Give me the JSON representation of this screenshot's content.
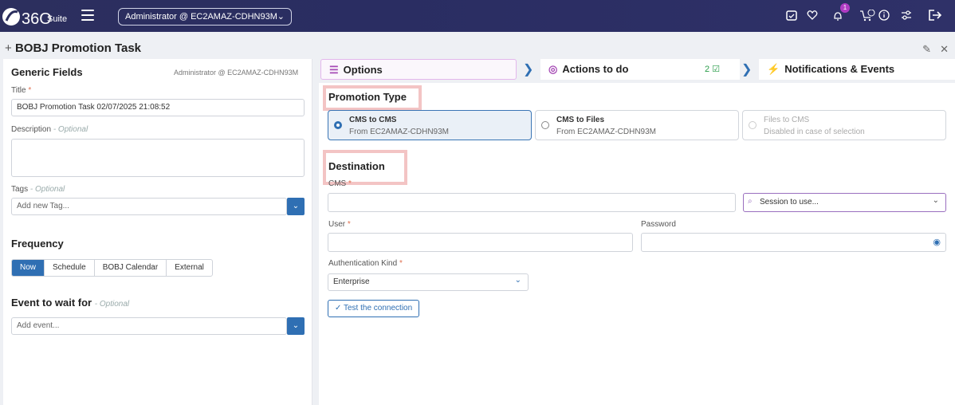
{
  "topbar": {
    "logo_text": "Suite",
    "user_select": "Administrator @ EC2AMAZ-CDHN93M",
    "notification_count": "1",
    "icons": [
      "calendar-check-icon",
      "heart-icon",
      "bell-icon",
      "cart-icon",
      "info-icon",
      "settings-icon",
      "logout-icon"
    ]
  },
  "page": {
    "title": "BOBJ Promotion Task",
    "title_prefix": "+"
  },
  "generic": {
    "heading": "Generic Fields",
    "user": "Administrator @ EC2AMAZ-CDHN93M",
    "title_label": "Title",
    "title_value": "BOBJ Promotion Task 02/07/2025 21:08:52",
    "description_label": "Description",
    "optional": "- Optional",
    "tags_label": "Tags",
    "tags_placeholder": "Add new Tag..."
  },
  "frequency": {
    "heading": "Frequency",
    "options": [
      "Now",
      "Schedule",
      "BOBJ Calendar",
      "External"
    ],
    "selected": "Now"
  },
  "event": {
    "heading": "Event to wait for",
    "optional": "- Optional",
    "placeholder": "Add event..."
  },
  "tabs": {
    "options": "Options",
    "actions": "Actions to do",
    "actions_count": "2",
    "notifications": "Notifications & Events"
  },
  "promotion": {
    "heading": "Promotion Type",
    "options": [
      {
        "title": "CMS to CMS",
        "sub": "From EC2AMAZ-CDHN93M"
      },
      {
        "title": "CMS to Files",
        "sub": "From EC2AMAZ-CDHN93M"
      },
      {
        "title": "Files to CMS",
        "sub": "Disabled in case of selection"
      }
    ]
  },
  "destination": {
    "heading": "Destination",
    "cms_label": "CMS",
    "session_placeholder": "Session to use...",
    "user_label": "User",
    "password_label": "Password",
    "auth_label": "Authentication Kind",
    "auth_value": "Enterprise",
    "test_button": "Test the connection"
  },
  "colors": {
    "topbar": "#2c2f5e",
    "accent": "#2f6fb3",
    "tab_accent": "#a64ab5",
    "highlight": "#f3c4c4"
  }
}
